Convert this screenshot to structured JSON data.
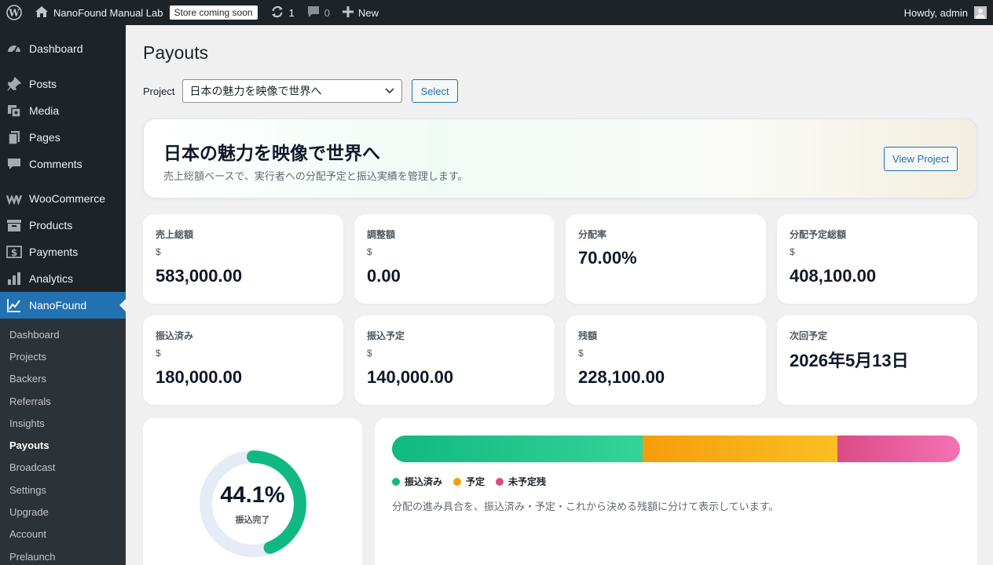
{
  "adminbar": {
    "site_name": "NanoFound Manual Lab",
    "store_badge": "Store coming soon",
    "updates_count": "1",
    "comments_count": "0",
    "new_label": "New",
    "greeting": "Howdy, admin"
  },
  "sidebar": {
    "items": [
      {
        "label": "Dashboard",
        "icon": "dashboard-icon"
      },
      {
        "label": "Posts",
        "icon": "pin-icon"
      },
      {
        "label": "Media",
        "icon": "media-icon"
      },
      {
        "label": "Pages",
        "icon": "pages-icon"
      },
      {
        "label": "Comments",
        "icon": "comment-icon"
      },
      {
        "label": "WooCommerce",
        "icon": "woocommerce-icon"
      },
      {
        "label": "Products",
        "icon": "archive-icon"
      },
      {
        "label": "Payments",
        "icon": "dollar-icon"
      },
      {
        "label": "Analytics",
        "icon": "bar-chart-icon"
      },
      {
        "label": "NanoFound",
        "icon": "chart-line-icon"
      }
    ],
    "submenu": [
      "Dashboard",
      "Projects",
      "Backers",
      "Referrals",
      "Insights",
      "Payouts",
      "Broadcast",
      "Settings",
      "Upgrade",
      "Account",
      "Prelaunch"
    ],
    "active_submenu": "Payouts"
  },
  "page": {
    "title": "Payouts",
    "project_label": "Project",
    "project_selected": "日本の魅力を映像で世界へ",
    "select_button": "Select"
  },
  "hero": {
    "title": "日本の魅力を映像で世界へ",
    "subtitle": "売上総額ベースで、実行者への分配予定と振込実績を管理します。",
    "view_button": "View Project"
  },
  "stats": {
    "gross": {
      "label": "売上総額",
      "currency": "$",
      "value": "583,000.00"
    },
    "adjust": {
      "label": "調整額",
      "currency": "$",
      "value": "0.00"
    },
    "rate": {
      "label": "分配率",
      "value": "70.00%"
    },
    "planned": {
      "label": "分配予定総額",
      "currency": "$",
      "value": "408,100.00"
    },
    "paid": {
      "label": "振込済み",
      "currency": "$",
      "value": "180,000.00"
    },
    "scheduled": {
      "label": "振込予定",
      "currency": "$",
      "value": "140,000.00"
    },
    "remaining": {
      "label": "残額",
      "currency": "$",
      "value": "228,100.00"
    },
    "next": {
      "label": "次回予定",
      "value": "2026年5月13日"
    }
  },
  "progress": {
    "percent": 44.1,
    "percent_text": "44.1%",
    "percent_label": "振込完了",
    "paid_fraction": 0.441,
    "scheduled_fraction": 0.343,
    "remaining_fraction": 0.216,
    "legend": {
      "paid": "振込済み",
      "scheduled": "予定",
      "remaining": "未予定残"
    },
    "note": "分配の進み具合を、振込済み・予定・これから決める残額に分けて表示しています。",
    "colors": {
      "paid": "#10b981",
      "scheduled": "#f59e0b",
      "remaining": "#db4b83",
      "track": "#e5ecf5"
    }
  }
}
